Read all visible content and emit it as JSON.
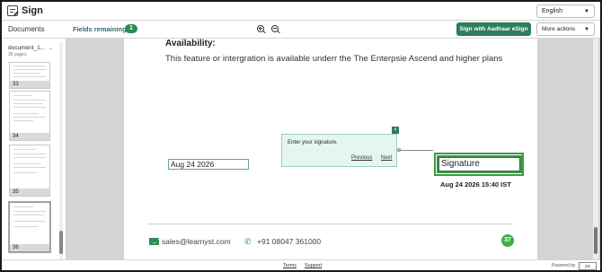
{
  "header": {
    "app_title": "Sign",
    "app_icon": "document-sign-icon",
    "language": "English"
  },
  "toolbar": {
    "documents_label": "Documents",
    "fields_remaining_label": "Fields remaining:",
    "fields_remaining_count": "1",
    "zoom_in_icon": "zoom-in-icon",
    "zoom_out_icon": "zoom-out-icon",
    "aadhaar_button": "Sign with Aadhaar eSign",
    "more_actions": "More actions"
  },
  "sidebar": {
    "document_name": "document_1...",
    "page_count": "36 pages",
    "thumbnails": [
      {
        "page": "33"
      },
      {
        "page": "34"
      },
      {
        "page": "35"
      },
      {
        "page": "36"
      }
    ]
  },
  "document": {
    "heading": "Availability:",
    "body": "This feature or intergration is available underr the The Enterpsie Ascend and higher plans",
    "date_field_value": "Aug 24 2026",
    "signature_field": "Signature",
    "signature_timestamp": "Aug 24 2026 15:40 IST",
    "popover": {
      "message": "Enter your signature.",
      "previous": "Previous",
      "next": "Next",
      "close": "×"
    },
    "footer": {
      "email": "sales@learnyst.com",
      "phone": "+91 08047 361000",
      "page_number": "37"
    }
  },
  "bottombar": {
    "terms": "Terms",
    "support": "Support",
    "powered_by": "Powered by",
    "powered_logo": "Zoho Sign"
  },
  "colors": {
    "accent_green": "#2e7d5b",
    "badge_green": "#2e8b57",
    "signature_border": "#3a9a45",
    "popover_bg": "#e4f6f2"
  }
}
